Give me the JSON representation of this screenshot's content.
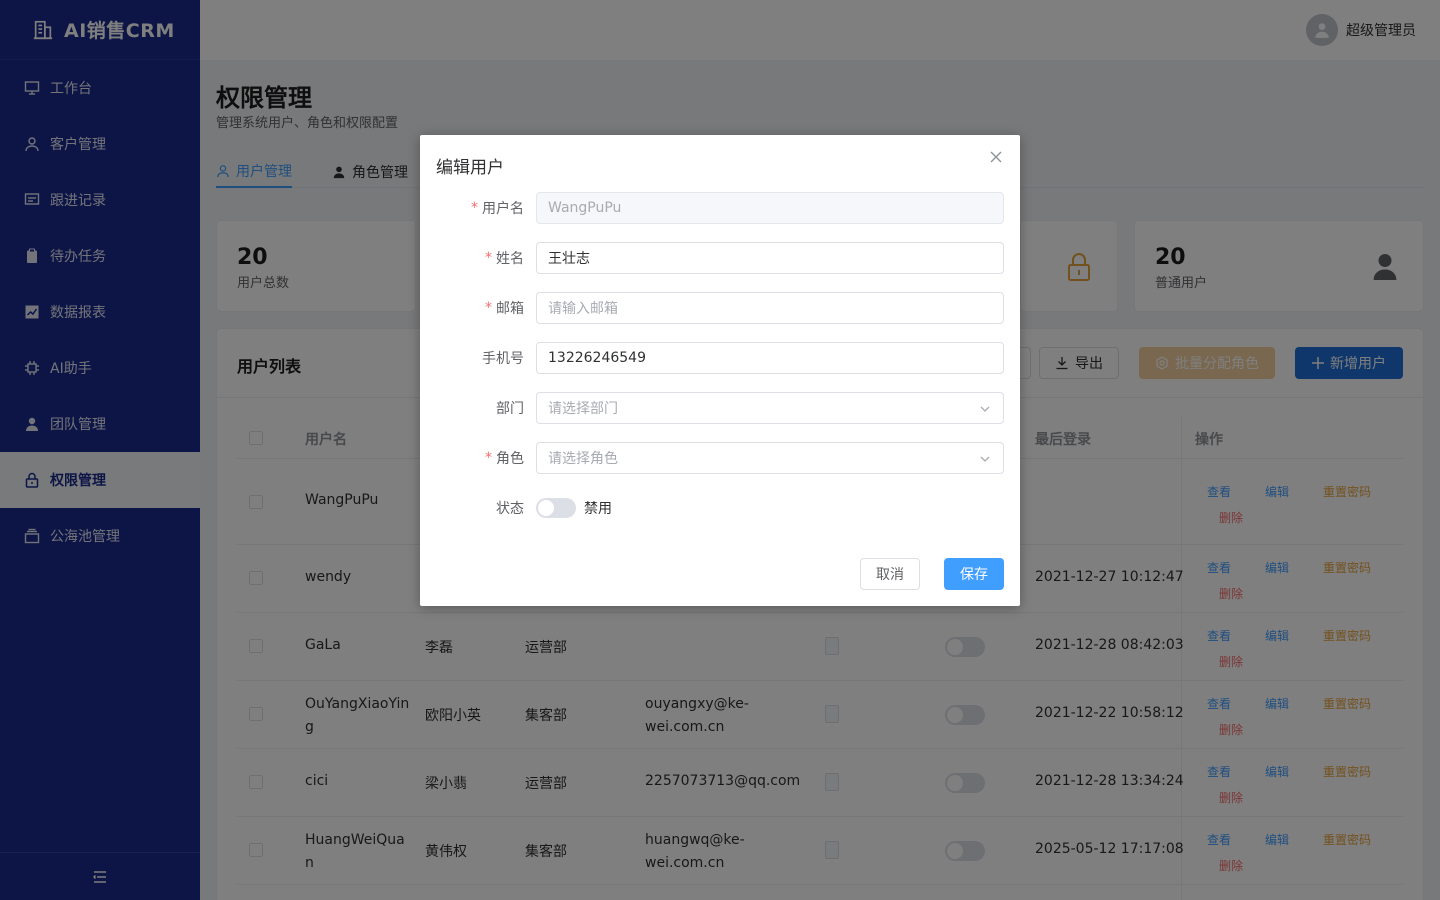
{
  "app": {
    "title": "AI销售CRM"
  },
  "sidebar": {
    "items": [
      {
        "label": "工作台",
        "icon": "dashboard-icon"
      },
      {
        "label": "客户管理",
        "icon": "user-icon"
      },
      {
        "label": "跟进记录",
        "icon": "message-icon"
      },
      {
        "label": "待办任务",
        "icon": "clipboard-icon"
      },
      {
        "label": "数据报表",
        "icon": "chart-icon"
      },
      {
        "label": "AI助手",
        "icon": "chip-icon"
      },
      {
        "label": "团队管理",
        "icon": "team-icon"
      },
      {
        "label": "权限管理",
        "icon": "lock-icon",
        "active": true
      },
      {
        "label": "公海池管理",
        "icon": "box-icon"
      }
    ]
  },
  "header": {
    "username": "超级管理员"
  },
  "page": {
    "title": "权限管理",
    "subtitle": "管理系统用户、角色和权限配置",
    "tabs": [
      {
        "label": "用户管理",
        "active": true
      },
      {
        "label": "角色管理"
      }
    ]
  },
  "stats": [
    {
      "value": "20",
      "label": "用户总数"
    },
    {
      "value": "20",
      "label": "普通用户"
    }
  ],
  "user_list": {
    "title": "用户列表",
    "export_label": "导出",
    "batch_label": "批量分配角色",
    "add_label": "新增用户",
    "columns": {
      "username": "用户名",
      "last_login": "最后登录",
      "ops": "操作"
    },
    "actions": {
      "view": "查看",
      "edit": "编辑",
      "reset": "重置密码",
      "delete": "删除"
    },
    "rows": [
      {
        "username": "WangPuPu",
        "name": "",
        "dept": "",
        "email": "",
        "last_login": ""
      },
      {
        "username": "wendy",
        "name": "",
        "dept": "",
        "email": "",
        "last_login": "2021-12-27 10:12:47"
      },
      {
        "username": "GaLa",
        "name": "李磊",
        "dept": "运营部",
        "email": "",
        "last_login": "2021-12-28 08:42:03"
      },
      {
        "username": "OuYangXiaoYin\ng",
        "name": "欧阳小英",
        "dept": "集客部",
        "email": "ouyangxy@ke-\nwei.com.cn",
        "last_login": "2021-12-22 10:58:12"
      },
      {
        "username": "cici",
        "name": "梁小翡",
        "dept": "运营部",
        "email": "2257073713@qq.com",
        "last_login": "2021-12-28 13:34:24"
      },
      {
        "username": "HuangWeiQua\nn",
        "name": "黄伟权",
        "dept": "集客部",
        "email": "huangwq@ke-\nwei.com.cn",
        "last_login": "2025-05-12 17:17:08"
      }
    ]
  },
  "dialog": {
    "title": "编辑用户",
    "fields": {
      "username": {
        "label": "用户名",
        "value": "WangPuPu"
      },
      "name": {
        "label": "姓名",
        "value": "王壮志"
      },
      "email": {
        "label": "邮箱",
        "placeholder": "请输入邮箱"
      },
      "phone": {
        "label": "手机号",
        "value": "13226246549"
      },
      "dept": {
        "label": "部门",
        "placeholder": "请选择部门"
      },
      "role": {
        "label": "角色",
        "placeholder": "请选择角色"
      },
      "status": {
        "label": "状态",
        "value": "禁用"
      }
    },
    "cancel_label": "取消",
    "save_label": "保存"
  }
}
